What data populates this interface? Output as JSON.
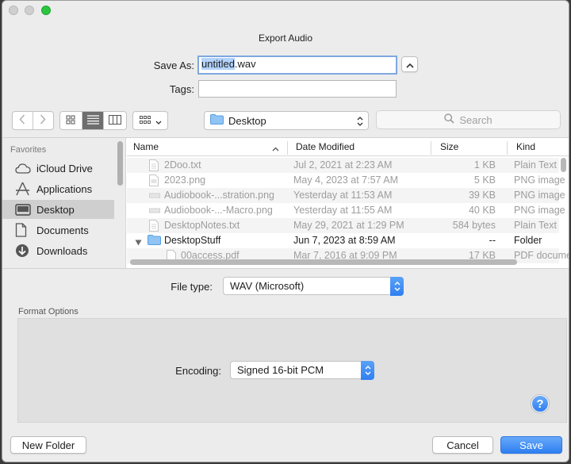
{
  "dialog": {
    "title": "Export Audio"
  },
  "save_as": {
    "label": "Save As:",
    "value_selected": "untitled",
    "value_rest": ".wav"
  },
  "tags": {
    "label": "Tags:",
    "value": ""
  },
  "toolbar": {
    "back_icon": "chevron-left-icon",
    "forward_icon": "chevron-right-icon",
    "view_modes": [
      "icon-grid-view",
      "list-view",
      "column-view"
    ],
    "active_view": "list-view",
    "location": "Desktop",
    "search_placeholder": "Search"
  },
  "sidebar": {
    "heading": "Favorites",
    "items": [
      {
        "label": "iCloud Drive",
        "icon": "cloud-icon"
      },
      {
        "label": "Applications",
        "icon": "applications-icon"
      },
      {
        "label": "Desktop",
        "icon": "desktop-icon",
        "selected": true
      },
      {
        "label": "Documents",
        "icon": "document-icon"
      },
      {
        "label": "Downloads",
        "icon": "download-icon"
      }
    ]
  },
  "file_list": {
    "columns": {
      "name": "Name",
      "date": "Date Modified",
      "size": "Size",
      "kind": "Kind"
    },
    "rows": [
      {
        "name": "2Doo.txt",
        "date": "Jul 2, 2021 at 2:23 AM",
        "size": "1 KB",
        "kind": "Plain Text"
      },
      {
        "name": "2023.png",
        "date": "May 4, 2023 at 7:57 AM",
        "size": "5 KB",
        "kind": "PNG image"
      },
      {
        "name": "Audiobook-...stration.png",
        "date": "Yesterday at 11:53 AM",
        "size": "39 KB",
        "kind": "PNG image"
      },
      {
        "name": "Audiobook-...-Macro.png",
        "date": "Yesterday at 11:55 AM",
        "size": "40 KB",
        "kind": "PNG image"
      },
      {
        "name": "DesktopNotes.txt",
        "date": "May 29, 2021 at 1:29 PM",
        "size": "584 bytes",
        "kind": "Plain Text"
      },
      {
        "name": "DesktopStuff",
        "date": "Jun 7, 2023 at 8:59 AM",
        "size": "--",
        "kind": "Folder"
      },
      {
        "name": "00access.pdf",
        "date": "Mar 7, 2016 at 9:09 PM",
        "size": "17 KB",
        "kind": "PDF document"
      }
    ]
  },
  "file_type": {
    "label": "File type:",
    "value": "WAV (Microsoft)"
  },
  "format_options": {
    "heading": "Format Options",
    "encoding_label": "Encoding:",
    "encoding_value": "Signed 16-bit PCM",
    "help": "?"
  },
  "buttons": {
    "new_folder": "New Folder",
    "cancel": "Cancel",
    "save": "Save"
  }
}
